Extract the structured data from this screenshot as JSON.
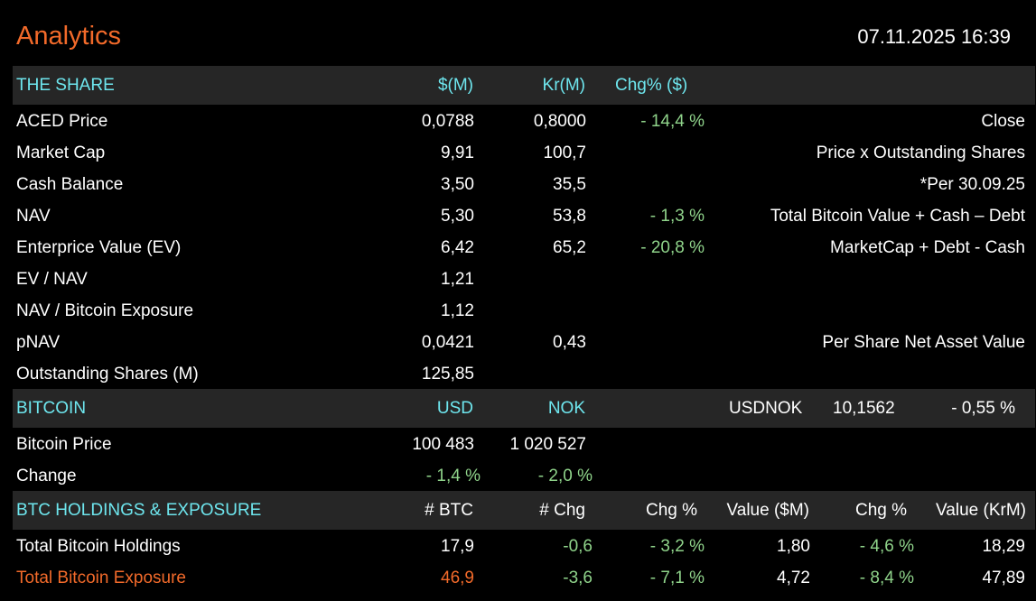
{
  "app": {
    "title": "Analytics",
    "datetime": "07.11.2025 16:39"
  },
  "share": {
    "header": {
      "label": "THE SHARE",
      "c1": "$(M)",
      "c2": "Kr(M)",
      "c3": "Chg% ($)"
    },
    "rows": [
      {
        "label": "ACED Price",
        "usd": "0,0788",
        "nok": "0,8000",
        "chg": "- 14,4 %",
        "note": "Close"
      },
      {
        "label": "Market Cap",
        "usd": "9,91",
        "nok": "100,7",
        "chg": "",
        "note": "Price x Outstanding Shares"
      },
      {
        "label": "Cash Balance",
        "usd": "3,50",
        "nok": "35,5",
        "chg": "",
        "note": "*Per 30.09.25"
      },
      {
        "label": "NAV",
        "usd": "5,30",
        "nok": "53,8",
        "chg": "- 1,3 %",
        "note": "Total Bitcoin Value + Cash – Debt"
      },
      {
        "label": "Enterprice Value (EV)",
        "usd": "6,42",
        "nok": "65,2",
        "chg": "- 20,8 %",
        "note": "MarketCap + Debt - Cash"
      },
      {
        "label": "EV / NAV",
        "usd": "1,21",
        "nok": "",
        "chg": "",
        "note": ""
      },
      {
        "label": "NAV / Bitcoin Exposure",
        "usd": "1,12",
        "nok": "",
        "chg": "",
        "note": ""
      },
      {
        "label": "pNAV",
        "usd": "0,0421",
        "nok": "0,43",
        "chg": "",
        "note": "Per Share Net Asset Value"
      },
      {
        "label": "Outstanding Shares (M)",
        "usd": "125,85",
        "nok": "",
        "chg": "",
        "note": ""
      }
    ]
  },
  "bitcoin": {
    "header": {
      "label": "BITCOIN",
      "c1": "USD",
      "c2": "NOK",
      "fx_label": "USDNOK",
      "fx_value": "10,1562",
      "fx_chg": "- 0,55 %"
    },
    "price": {
      "label": "Bitcoin Price",
      "usd": "100 483",
      "nok": "1 020 527"
    },
    "change": {
      "label": "Change",
      "usd": "- 1,4 %",
      "nok": "- 2,0 %"
    }
  },
  "holdings": {
    "header": {
      "label": "BTC HOLDINGS & EXPOSURE",
      "c1": "# BTC",
      "c2": "# Chg",
      "c3": "Chg %",
      "c4": "Value ($M)",
      "c5": "Chg %",
      "c6": "Value (KrM)"
    },
    "rows": [
      {
        "label": "Total Bitcoin Holdings",
        "btc": "17,9",
        "chg": "-0,6",
        "chg_pct": "- 3,2 %",
        "value_usd": "1,80",
        "chg_pct2": "- 4,6 %",
        "value_nok": "18,29"
      },
      {
        "label": "Total Bitcoin Exposure",
        "btc": "46,9",
        "chg": "-3,6",
        "chg_pct": "- 7,1 %",
        "value_usd": "4,72",
        "chg_pct2": "- 8,4 %",
        "value_nok": "47,89"
      }
    ]
  },
  "colors": {
    "accent": "#f26a2a",
    "header_text": "#6ee6ee",
    "positive_text": "#8fd38a",
    "band": "#262626"
  }
}
